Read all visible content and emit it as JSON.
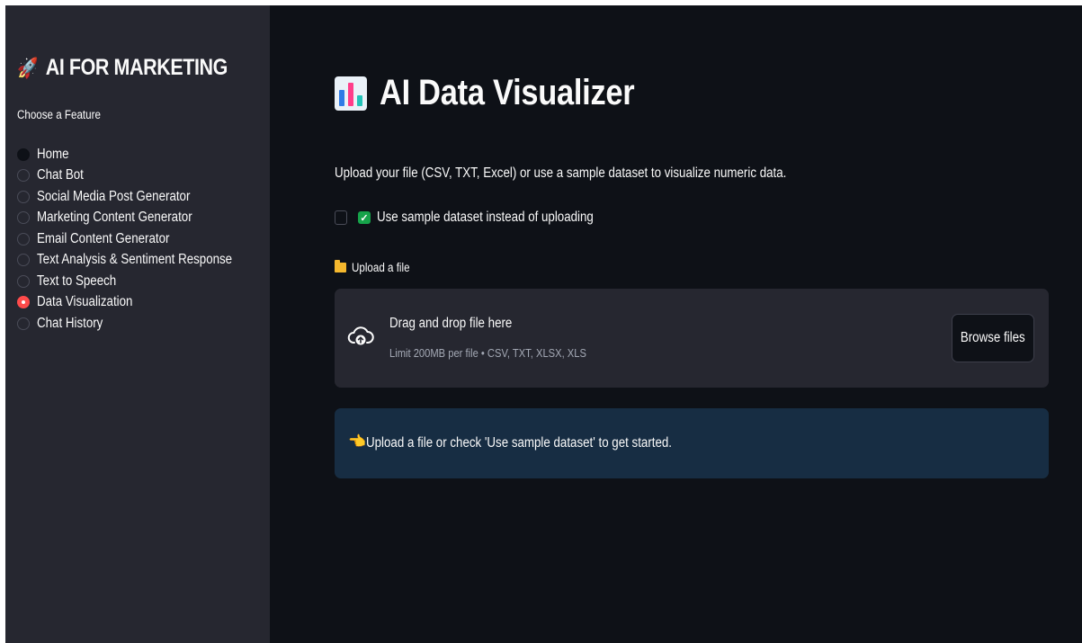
{
  "sidebar": {
    "title": "AI FOR MARKETING",
    "title_icon": "rocket-icon",
    "choose_label": "Choose a Feature",
    "items": [
      {
        "label": "Home",
        "selected": false
      },
      {
        "label": "Chat Bot",
        "selected": false
      },
      {
        "label": "Social Media Post Generator",
        "selected": false
      },
      {
        "label": "Marketing Content Generator",
        "selected": false
      },
      {
        "label": "Email Content Generator",
        "selected": false
      },
      {
        "label": "Text Analysis & Sentiment Response",
        "selected": false
      },
      {
        "label": "Text to Speech",
        "selected": false
      },
      {
        "label": "Data Visualization",
        "selected": true
      },
      {
        "label": "Chat History",
        "selected": false
      }
    ]
  },
  "main": {
    "title": "AI Data Visualizer",
    "title_icon": "bar-chart-icon",
    "description": "Upload your file (CSV, TXT, Excel) or use a sample dataset to visualize numeric data.",
    "sample_checkbox": {
      "label": "Use sample dataset instead of uploading",
      "checked": false,
      "label_icon": "green-check-icon"
    },
    "uploader": {
      "label": "Upload a file",
      "label_icon": "folder-icon",
      "drag_text": "Drag and drop file here",
      "limit_text": "Limit 200MB per file • CSV, TXT, XLSX, XLS",
      "browse_label": "Browse files"
    },
    "info": {
      "icon": "pointing-hand-icon",
      "text": "Upload a file or check 'Use sample dataset' to get started."
    }
  },
  "colors": {
    "sidebar_bg": "#262730",
    "main_bg": "#0e1117",
    "accent": "#ff4b4b",
    "info_bg": "#172d43",
    "check_green": "#16a34a"
  }
}
